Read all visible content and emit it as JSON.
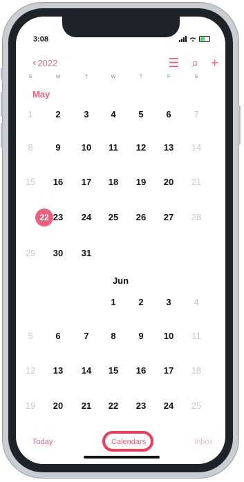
{
  "status": {
    "time": "3:08"
  },
  "nav": {
    "back_label": "2022"
  },
  "weekdays": [
    "S",
    "M",
    "T",
    "W",
    "T",
    "F",
    "S"
  ],
  "may": {
    "label": "May",
    "weeks": [
      [
        "1",
        "2",
        "3",
        "4",
        "5",
        "6",
        "7"
      ],
      [
        "8",
        "9",
        "10",
        "11",
        "12",
        "13",
        "14"
      ],
      [
        "15",
        "16",
        "17",
        "18",
        "19",
        "20",
        "21"
      ],
      [
        "22",
        "23",
        "24",
        "25",
        "26",
        "27",
        "28"
      ],
      [
        "29",
        "30",
        "31",
        "",
        "",
        "",
        ""
      ]
    ]
  },
  "jun": {
    "label": "Jun",
    "weeks": [
      [
        "",
        "",
        "",
        "1",
        "2",
        "3",
        "4"
      ],
      [
        "5",
        "6",
        "7",
        "8",
        "9",
        "10",
        "11"
      ],
      [
        "12",
        "13",
        "14",
        "15",
        "16",
        "17",
        "18"
      ],
      [
        "19",
        "20",
        "21",
        "22",
        "23",
        "24",
        "25"
      ]
    ]
  },
  "tabs": {
    "today": "Today",
    "calendars": "Calendars",
    "inbox": "Inbox"
  },
  "colors": {
    "accent": "#ef5f7e",
    "highlight": "#ef3c59"
  }
}
